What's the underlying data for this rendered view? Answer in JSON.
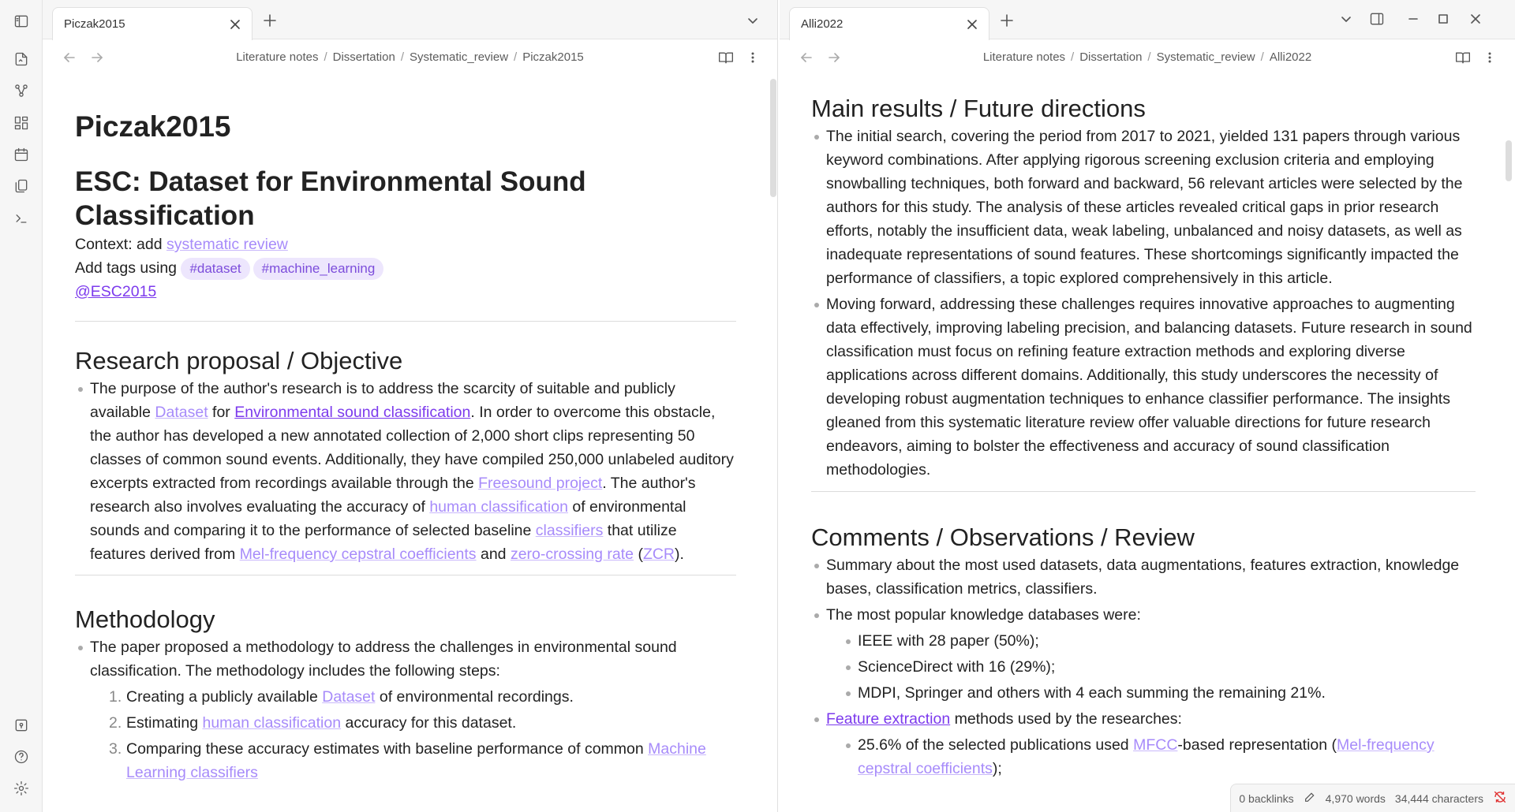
{
  "left": {
    "tab_title": "Piczak2015",
    "breadcrumbs": [
      "Literature notes",
      "Dissertation",
      "Systematic_review",
      "Piczak2015"
    ],
    "note_title": "Piczak2015",
    "heading": "ESC: Dataset for Environmental Sound Classification",
    "context_label": "Context: add",
    "context_link": "systematic review",
    "tags_label": "Add tags using",
    "tags": [
      "#dataset",
      "#machine_learning"
    ],
    "citekey": "@ESC2015",
    "research": {
      "heading": "Research proposal / Objective",
      "p1": "The purpose of the author's research is to address the scarcity of suitable and publicly available",
      "l1": "Dataset",
      "p2": "for",
      "l2": "Environmental sound classification",
      "p3": ". In order to overcome this obstacle, the author has developed a new annotated collection of 2,000 short clips representing 50 classes of common sound events. Additionally, they have compiled 250,000 unlabeled auditory excerpts extracted from recordings available through the",
      "l3": "Freesound project",
      "p4": ". The author's research also involves evaluating the accuracy of",
      "l4": "human classification",
      "p5": "of environmental sounds and comparing it to the performance of selected baseline",
      "l5": "classifiers",
      "p6": "that utilize features derived from",
      "l6": "Mel-frequency cepstral coefficients",
      "p7": "and",
      "l7": "zero-crossing rate",
      "p8": "(",
      "l8": "ZCR",
      "p9": ")."
    },
    "methodology": {
      "heading": "Methodology",
      "intro": "The paper proposed a methodology to address the challenges in environmental sound classification. The methodology includes the following steps:",
      "s1a": "Creating a publicly available",
      "s1l": "Dataset",
      "s1b": "of environmental recordings.",
      "s2a": "Estimating",
      "s2l": "human classification",
      "s2b": "accuracy for this dataset.",
      "s3a": "Comparing these accuracy estimates with baseline performance of common",
      "s3l": "Machine Learning classifiers"
    }
  },
  "right": {
    "tab_title": "Alli2022",
    "breadcrumbs": [
      "Literature notes",
      "Dissertation",
      "Systematic_review",
      "Alli2022"
    ],
    "main": {
      "heading": "Main results / Future directions",
      "b1": "The initial search, covering the period from 2017 to 2021, yielded 131 papers through various keyword combinations. After applying rigorous screening exclusion criteria and employing snowballing techniques, both forward and backward, 56 relevant articles were selected by the authors for this study. The analysis of these articles revealed critical gaps in prior research efforts, notably the insufficient data, weak labeling, unbalanced and noisy datasets, as well as inadequate representations of sound features. These shortcomings significantly impacted the performance of classifiers, a topic explored comprehensively in this article.",
      "b2": "Moving forward, addressing these challenges requires innovative approaches to augmenting data effectively, improving labeling precision, and balancing datasets. Future research in sound classification must focus on refining feature extraction methods and exploring diverse applications across different domains. Additionally, this study underscores the necessity of developing robust augmentation techniques to enhance classifier performance. The insights gleaned from this systematic literature review offer valuable directions for future research endeavors, aiming to bolster the effectiveness and accuracy of sound classification methodologies."
    },
    "comments": {
      "heading": "Comments / Observations / Review",
      "b1": "Summary about the most used datasets, data augmentations, features extraction, knowledge bases, classification metrics, classifiers.",
      "b2": "The most popular knowledge databases were:",
      "kb": [
        "IEEE with 28 paper (50%);",
        "ScienceDirect with 16 (29%);",
        "MDPI, Springer and others with 4 each summing the remaining 21%."
      ],
      "fe_link": "Feature extraction",
      "fe_text": "methods used by the researches:",
      "fe1a": "25.6% of the selected publications used",
      "fe1l": "MFCC",
      "fe1b": "-based representation (",
      "fe1l2": "Mel-frequency cepstral coefficients",
      "fe1c": ");"
    },
    "status": {
      "backlinks": "0 backlinks",
      "words": "4,970 words",
      "chars": "34,444 characters"
    }
  },
  "icons": [
    "sidebar-toggle-icon",
    "open-file-icon",
    "graph-icon",
    "canvas-icon",
    "calendar-icon",
    "copy-icon",
    "terminal-icon",
    "vault-icon",
    "help-icon",
    "settings-icon"
  ],
  "colors": {
    "accent": "#7c3aed",
    "internal_link": "#a78bfa",
    "tag_bg": "#ede6fd",
    "sync_error": "#e03131"
  }
}
